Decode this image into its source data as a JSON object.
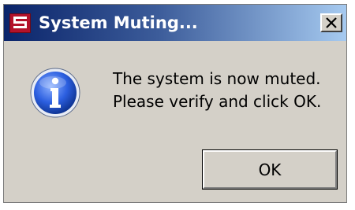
{
  "window": {
    "title": "System Muting...",
    "app_icon": "app-logo-icon",
    "close_icon": "close-icon"
  },
  "dialog": {
    "icon": "info-icon",
    "message_line1": "The system is now muted.",
    "message_line2": "Please verify and click OK.",
    "ok_label": "OK"
  },
  "colors": {
    "titlebar_start": "#0a246a",
    "titlebar_end": "#a6caf0",
    "window_bg": "#d4d0c8",
    "info_blue": "#1f4fd0"
  }
}
